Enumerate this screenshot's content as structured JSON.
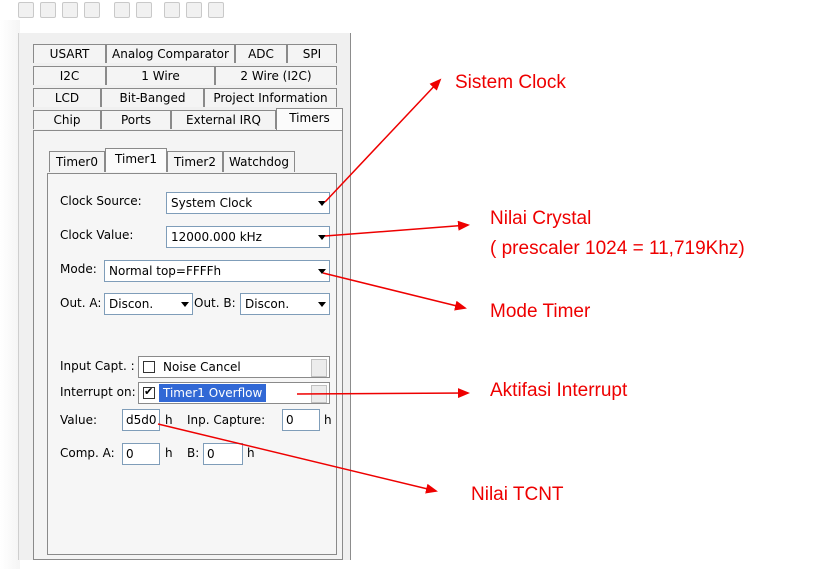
{
  "tab_rows": [
    [
      "USART",
      "Analog Comparator",
      "ADC",
      "SPI"
    ],
    [
      "I2C",
      "1 Wire",
      "2 Wire (I2C)"
    ],
    [
      "LCD",
      "Bit-Banged",
      "Project Information"
    ],
    [
      "Chip",
      "Ports",
      "External IRQ",
      "Timers"
    ]
  ],
  "active_tab": "Timers",
  "timer_tabs": [
    "Timer0",
    "Timer1",
    "Timer2",
    "Watchdog"
  ],
  "active_timer_tab": "Timer1",
  "clock_source": {
    "label": "Clock Source:",
    "value": "System Clock"
  },
  "clock_value": {
    "label": "Clock Value:",
    "value": "12000.000 kHz"
  },
  "mode": {
    "label": "Mode:",
    "value": "Normal top=FFFFh"
  },
  "out_a": {
    "label": "Out. A:",
    "value": "Discon."
  },
  "out_b": {
    "label": "Out. B:",
    "value": "Discon."
  },
  "input_capt": {
    "label": "Input Capt. :",
    "option": "Noise Cancel",
    "checked": false
  },
  "interrupt_on": {
    "label": "Interrupt on:",
    "option": "Timer1 Overflow",
    "checked": true
  },
  "value": {
    "label": "Value:",
    "value": "d5d0",
    "unit": "h"
  },
  "inp_capture": {
    "label": "Inp. Capture:",
    "value": "0",
    "unit": "h"
  },
  "comp_a": {
    "label": "Comp. A:",
    "value": "0",
    "unit": "h"
  },
  "comp_b": {
    "label": "B:",
    "value": "0",
    "unit": "h"
  },
  "annotations": {
    "sistem_clock": "Sistem Clock",
    "nilai_crystal": "Nilai Crystal",
    "prescaler": "( prescaler 1024 = 11,719Khz)",
    "mode_timer": "Mode Timer",
    "aktifasi_interrupt": "Aktifasi Interrupt",
    "nilai_tcnt": "Nilai TCNT"
  },
  "colors": {
    "annotation": "#ee0000",
    "selection": "#3168d5",
    "panel": "#f0f0f0"
  }
}
